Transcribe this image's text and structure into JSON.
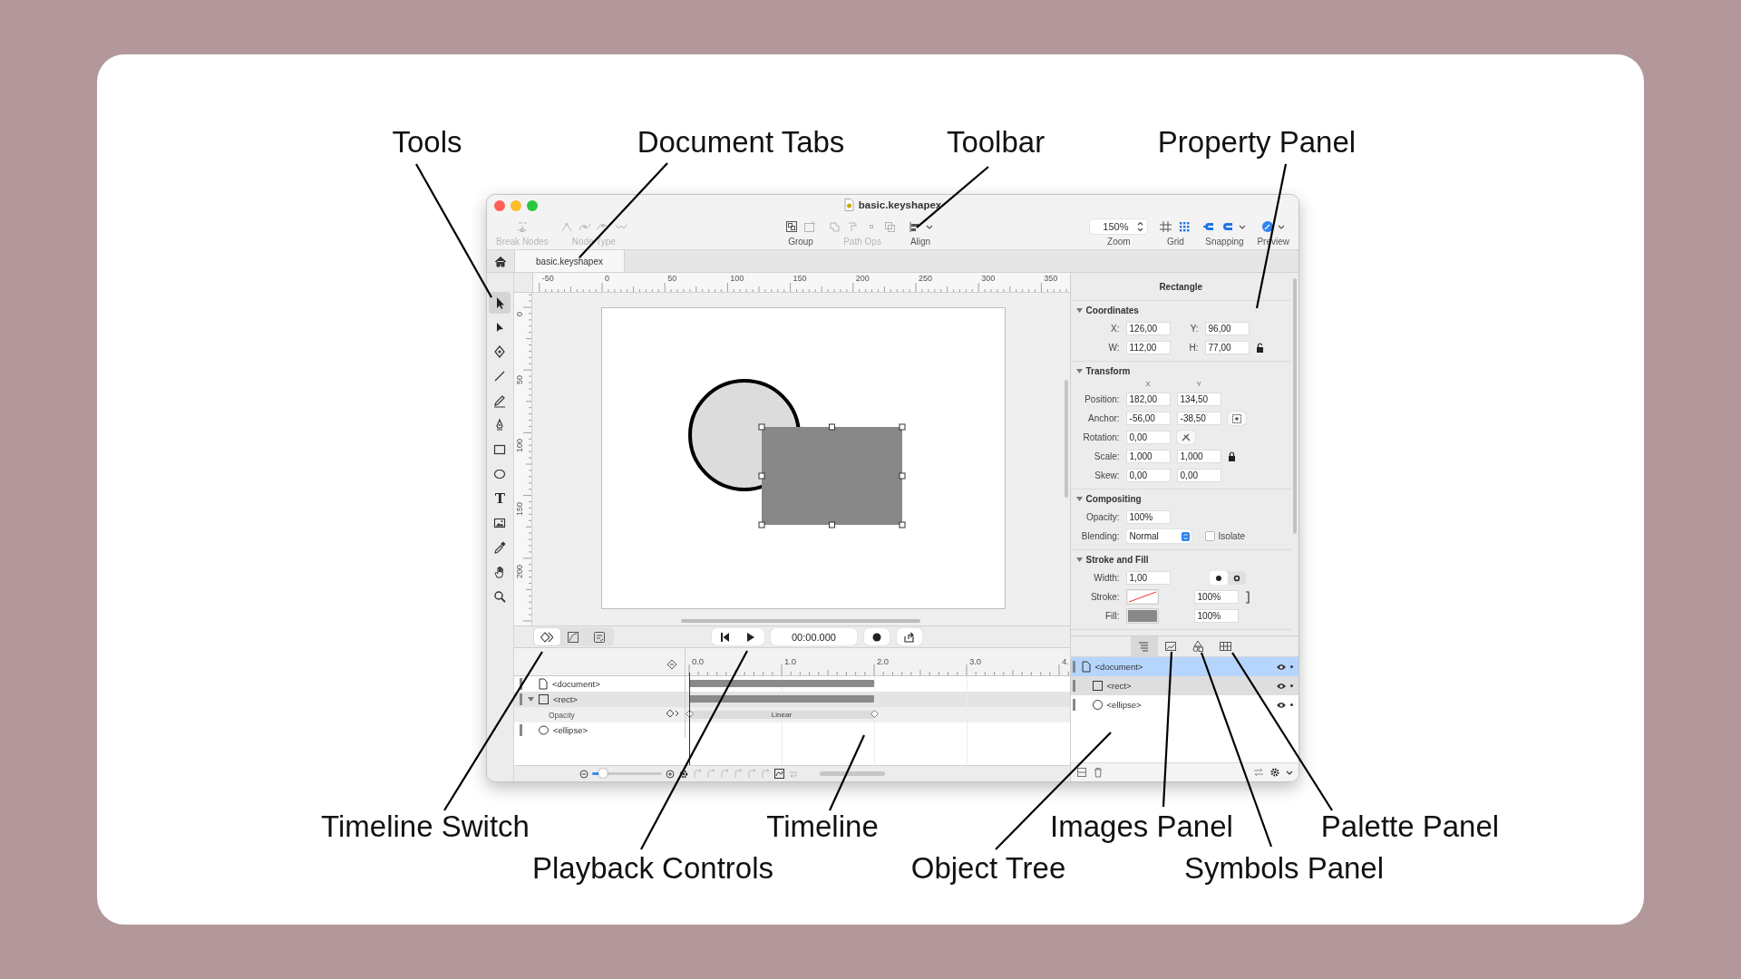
{
  "callouts": [
    {
      "label": "Tools"
    },
    {
      "label": "Document Tabs"
    },
    {
      "label": "Toolbar"
    },
    {
      "label": "Property Panel"
    },
    {
      "label": "Timeline Switch"
    },
    {
      "label": "Playback Controls"
    },
    {
      "label": "Timeline"
    },
    {
      "label": "Object Tree"
    },
    {
      "label": "Images Panel"
    },
    {
      "label": "Symbols Panel"
    },
    {
      "label": "Palette Panel"
    }
  ],
  "window": {
    "title": "basic.keyshapex"
  },
  "toolbar": {
    "left": [
      {
        "kind": "break-nodes",
        "label": "Break Nodes",
        "disabled": true
      },
      {
        "kind": "node-type",
        "label": "Node Type",
        "disabled": true
      }
    ],
    "center": [
      {
        "kind": "group",
        "label": "Group",
        "disabled": false
      },
      {
        "kind": "path-ops",
        "label": "Path Ops",
        "disabled": true
      },
      {
        "kind": "align",
        "label": "Align",
        "disabled": false
      }
    ],
    "right": [
      {
        "kind": "zoom",
        "label": "Zoom",
        "value": "150%",
        "disabled": false
      },
      {
        "kind": "grid",
        "label": "Grid",
        "disabled": false
      },
      {
        "kind": "snapping",
        "label": "Snapping",
        "disabled": false
      },
      {
        "kind": "preview",
        "label": "Preview",
        "disabled": false
      }
    ]
  },
  "document_tabs": [
    {
      "label": "basic.keyshapex",
      "selected": true
    }
  ],
  "tools": [
    {
      "kind": "select",
      "selected": true
    },
    {
      "kind": "direct-select",
      "selected": false
    },
    {
      "kind": "node",
      "selected": false
    },
    {
      "kind": "line",
      "selected": false
    },
    {
      "kind": "pencil",
      "selected": false
    },
    {
      "kind": "pen",
      "selected": false
    },
    {
      "kind": "rectangle",
      "selected": false
    },
    {
      "kind": "ellipse",
      "selected": false
    },
    {
      "kind": "text",
      "glyph": "T",
      "selected": false
    },
    {
      "kind": "image",
      "selected": false
    },
    {
      "kind": "eyedropper",
      "selected": false
    },
    {
      "kind": "hand",
      "selected": false
    },
    {
      "kind": "zoom",
      "selected": false
    }
  ],
  "rulers": {
    "horizontal": [
      "-50",
      "0",
      "50",
      "100",
      "150",
      "200",
      "250",
      "300",
      "350"
    ],
    "vertical": [
      "0",
      "50",
      "100",
      "150",
      "200"
    ]
  },
  "canvas": {
    "shapes": [
      {
        "kind": "ellipse",
        "selected": false
      },
      {
        "kind": "rectangle",
        "selected": true
      }
    ]
  },
  "property_panel": {
    "title": "Rectangle",
    "sections": [
      {
        "title": "Coordinates",
        "expanded": true,
        "rows": [
          {
            "kind": "pair",
            "fields": [
              {
                "label": "X:",
                "value": "126,00"
              },
              {
                "label": "Y:",
                "value": "96,00"
              }
            ]
          },
          {
            "kind": "pair",
            "fields": [
              {
                "label": "W:",
                "value": "112,00"
              },
              {
                "label": "H:",
                "value": "77,00"
              }
            ],
            "locked": false
          }
        ]
      },
      {
        "title": "Transform",
        "expanded": true,
        "columns": [
          "X",
          "Y"
        ],
        "rows": [
          {
            "kind": "fields",
            "label": "Position:",
            "values": [
              "182,00",
              "134,50"
            ]
          },
          {
            "kind": "fields",
            "label": "Anchor:",
            "values": [
              "-56,00",
              "-38,50"
            ],
            "accessory": {
              "kind": "anchor"
            }
          },
          {
            "kind": "fields",
            "label": "Rotation:",
            "values": [
              "0,00"
            ],
            "accessory": {
              "kind": "rotate"
            }
          },
          {
            "kind": "fields",
            "label": "Scale:",
            "values": [
              "1,000",
              "1,000"
            ],
            "locked": true
          },
          {
            "kind": "fields",
            "label": "Skew:",
            "values": [
              "0,00",
              "0,00"
            ]
          }
        ]
      },
      {
        "title": "Compositing",
        "expanded": true,
        "rows": [
          {
            "kind": "fields",
            "label": "Opacity:",
            "values": [
              "100%"
            ]
          },
          {
            "kind": "select",
            "label": "Blending:",
            "value": "Normal",
            "checkbox": {
              "label": "Isolate",
              "checked": false
            }
          }
        ]
      },
      {
        "title": "Stroke and Fill",
        "expanded": true,
        "rows": [
          {
            "kind": "fields",
            "label": "Width:",
            "values": [
              "1,00"
            ],
            "accessory": {
              "kind": "stroke-style"
            }
          },
          {
            "kind": "paint",
            "label": "Stroke:",
            "opacity": "100%"
          },
          {
            "kind": "paint",
            "label": "Fill:",
            "color": "#888888",
            "opacity": "100%"
          }
        ]
      }
    ]
  },
  "timeline": {
    "switch": [
      {
        "kind": "keyframes",
        "selected": true
      },
      {
        "kind": "curves",
        "selected": false
      },
      {
        "kind": "script",
        "selected": false
      }
    ],
    "time": "00:00.000",
    "ticks": [
      "0.0",
      "1.0",
      "2.0",
      "3.0",
      "4."
    ],
    "layers": [
      {
        "name": "<document>",
        "kind": "document",
        "marked": false,
        "bar": true
      },
      {
        "name": "<rect>",
        "kind": "rect",
        "marked": true,
        "bar": true,
        "expanded": true,
        "children": [
          {
            "name": "Opacity",
            "kind": "property",
            "interpolation": "Linear"
          }
        ]
      },
      {
        "name": "<ellipse>",
        "kind": "ellipse",
        "marked": false,
        "bar": false
      }
    ],
    "zoom_slider": {
      "level": 0.16
    }
  },
  "object_tree": {
    "tabs": [
      {
        "kind": "tree",
        "selected": true
      },
      {
        "kind": "images",
        "selected": false
      },
      {
        "kind": "symbols",
        "selected": false
      },
      {
        "kind": "palette",
        "selected": false
      }
    ],
    "items": [
      {
        "name": "<document>",
        "kind": "document",
        "selected": true,
        "marked": false,
        "children": [
          {
            "name": "<rect>",
            "kind": "rect",
            "selected": false,
            "marked": true
          },
          {
            "name": "<ellipse>",
            "kind": "ellipse",
            "selected": false,
            "marked": false
          }
        ]
      }
    ]
  }
}
